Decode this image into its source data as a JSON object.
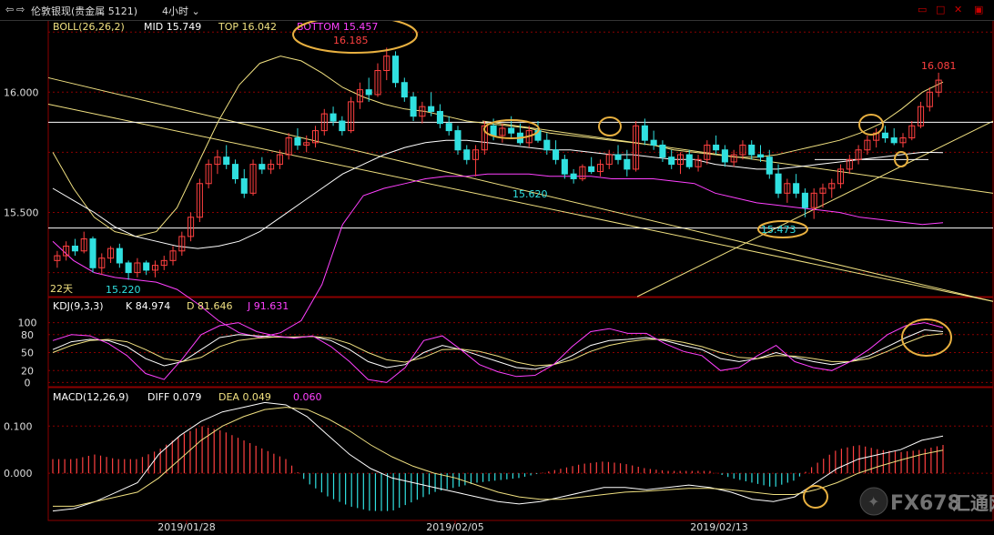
{
  "toolbar": {
    "instrument": "伦敦银现(贵金属 5121)",
    "period": "4小时"
  },
  "colors": {
    "up": "#ff4040",
    "down": "#30e0e0",
    "yellow": "#f0e080",
    "magenta": "#ff40ff",
    "white": "#ffffff",
    "orange": "#e8b040"
  },
  "boll": {
    "header": "BOLL(26,26,2)",
    "mid_label": "MID 15.749",
    "top_label": "TOP 16.042",
    "bottom_label": "BOTTOM 15.457"
  },
  "kdj": {
    "header": "KDJ(9,3,3)",
    "k_label": "K 84.974",
    "d_label": "D 81.646",
    "j_label": "J 91.631"
  },
  "macd": {
    "header": "MACD(12,26,9)",
    "diff_label": "DIFF 0.079",
    "dea_label": "DEA 0.049",
    "hist_label": "0.060"
  },
  "annotations": {
    "high": "16.185",
    "last_high": "16.081",
    "low1": "15.620",
    "low2": "15.473",
    "left_low": "15.220",
    "days": "22天"
  },
  "watermark": {
    "brand": "FX678",
    "cn": "汇通网"
  },
  "chart_data": [
    {
      "type": "candlestick",
      "title": "伦敦银现(贵金属 5121) 4小时",
      "yticks": [
        "16.000",
        "15.500"
      ],
      "ylim": [
        15.15,
        16.3
      ],
      "xticks": [
        "2019/01/28",
        "2019/02/05",
        "2019/02/13"
      ],
      "ohlc": [
        [
          15.3,
          15.34,
          15.27,
          15.32
        ],
        [
          15.32,
          15.38,
          15.3,
          15.36
        ],
        [
          15.36,
          15.39,
          15.32,
          15.34
        ],
        [
          15.34,
          15.42,
          15.33,
          15.39
        ],
        [
          15.39,
          15.4,
          15.25,
          15.27
        ],
        [
          15.27,
          15.33,
          15.24,
          15.31
        ],
        [
          15.31,
          15.36,
          15.29,
          15.35
        ],
        [
          15.35,
          15.37,
          15.27,
          15.29
        ],
        [
          15.29,
          15.3,
          15.22,
          15.25
        ],
        [
          15.25,
          15.31,
          15.23,
          15.29
        ],
        [
          15.29,
          15.3,
          15.24,
          15.26
        ],
        [
          15.26,
          15.3,
          15.23,
          15.28
        ],
        [
          15.28,
          15.32,
          15.26,
          15.3
        ],
        [
          15.3,
          15.36,
          15.28,
          15.34
        ],
        [
          15.34,
          15.42,
          15.32,
          15.4
        ],
        [
          15.4,
          15.5,
          15.38,
          15.48
        ],
        [
          15.48,
          15.64,
          15.46,
          15.62
        ],
        [
          15.62,
          15.72,
          15.6,
          15.7
        ],
        [
          15.7,
          15.76,
          15.66,
          15.73
        ],
        [
          15.73,
          15.78,
          15.68,
          15.7
        ],
        [
          15.7,
          15.72,
          15.62,
          15.64
        ],
        [
          15.64,
          15.68,
          15.56,
          15.58
        ],
        [
          15.58,
          15.72,
          15.57,
          15.7
        ],
        [
          15.7,
          15.73,
          15.66,
          15.68
        ],
        [
          15.68,
          15.72,
          15.66,
          15.7
        ],
        [
          15.7,
          15.76,
          15.68,
          15.74
        ],
        [
          15.74,
          15.83,
          15.72,
          15.81
        ],
        [
          15.81,
          15.85,
          15.76,
          15.78
        ],
        [
          15.78,
          15.82,
          15.75,
          15.79
        ],
        [
          15.79,
          15.86,
          15.77,
          15.84
        ],
        [
          15.84,
          15.93,
          15.82,
          15.91
        ],
        [
          15.91,
          15.94,
          15.86,
          15.88
        ],
        [
          15.88,
          15.9,
          15.82,
          15.84
        ],
        [
          15.84,
          15.98,
          15.83,
          15.96
        ],
        [
          15.96,
          16.04,
          15.93,
          16.01
        ],
        [
          16.01,
          16.06,
          15.96,
          15.99
        ],
        [
          15.99,
          16.12,
          15.98,
          16.09
        ],
        [
          16.09,
          16.185,
          16.05,
          16.15
        ],
        [
          16.15,
          16.17,
          16.02,
          16.04
        ],
        [
          16.04,
          16.06,
          15.96,
          15.98
        ],
        [
          15.98,
          16.0,
          15.88,
          15.9
        ],
        [
          15.9,
          15.96,
          15.87,
          15.94
        ],
        [
          15.94,
          16.0,
          15.9,
          15.92
        ],
        [
          15.92,
          15.95,
          15.85,
          15.87
        ],
        [
          15.87,
          15.9,
          15.82,
          15.84
        ],
        [
          15.84,
          15.86,
          15.74,
          15.76
        ],
        [
          15.76,
          15.78,
          15.7,
          15.72
        ],
        [
          15.72,
          15.78,
          15.65,
          15.76
        ],
        [
          15.76,
          15.88,
          15.74,
          15.86
        ],
        [
          15.86,
          15.89,
          15.8,
          15.82
        ],
        [
          15.82,
          15.87,
          15.79,
          15.85
        ],
        [
          15.85,
          15.9,
          15.81,
          15.83
        ],
        [
          15.83,
          15.87,
          15.78,
          15.79
        ],
        [
          15.79,
          15.86,
          15.77,
          15.84
        ],
        [
          15.84,
          15.88,
          15.79,
          15.8
        ],
        [
          15.8,
          15.83,
          15.74,
          15.76
        ],
        [
          15.76,
          15.8,
          15.7,
          15.72
        ],
        [
          15.72,
          15.74,
          15.64,
          15.66
        ],
        [
          15.66,
          15.68,
          15.62,
          15.64
        ],
        [
          15.64,
          15.7,
          15.63,
          15.69
        ],
        [
          15.69,
          15.73,
          15.66,
          15.67
        ],
        [
          15.67,
          15.72,
          15.65,
          15.7
        ],
        [
          15.7,
          15.76,
          15.68,
          15.74
        ],
        [
          15.74,
          15.78,
          15.7,
          15.72
        ],
        [
          15.72,
          15.76,
          15.65,
          15.68
        ],
        [
          15.68,
          15.88,
          15.67,
          15.86
        ],
        [
          15.86,
          15.89,
          15.78,
          15.8
        ],
        [
          15.8,
          15.84,
          15.76,
          15.78
        ],
        [
          15.78,
          15.8,
          15.71,
          15.73
        ],
        [
          15.73,
          15.76,
          15.68,
          15.7
        ],
        [
          15.7,
          15.75,
          15.66,
          15.74
        ],
        [
          15.74,
          15.76,
          15.68,
          15.69
        ],
        [
          15.69,
          15.74,
          15.67,
          15.72
        ],
        [
          15.72,
          15.8,
          15.7,
          15.78
        ],
        [
          15.78,
          15.82,
          15.74,
          15.76
        ],
        [
          15.76,
          15.78,
          15.69,
          15.71
        ],
        [
          15.71,
          15.76,
          15.69,
          15.74
        ],
        [
          15.74,
          15.8,
          15.72,
          15.78
        ],
        [
          15.78,
          15.8,
          15.72,
          15.74
        ],
        [
          15.74,
          15.78,
          15.71,
          15.73
        ],
        [
          15.73,
          15.76,
          15.64,
          15.66
        ],
        [
          15.66,
          15.7,
          15.56,
          15.58
        ],
        [
          15.58,
          15.64,
          15.54,
          15.62
        ],
        [
          15.62,
          15.66,
          15.56,
          15.58
        ],
        [
          15.58,
          15.6,
          15.48,
          15.52
        ],
        [
          15.52,
          15.6,
          15.473,
          15.58
        ],
        [
          15.58,
          15.62,
          15.52,
          15.6
        ],
        [
          15.6,
          15.64,
          15.56,
          15.62
        ],
        [
          15.62,
          15.7,
          15.6,
          15.68
        ],
        [
          15.68,
          15.74,
          15.66,
          15.72
        ],
        [
          15.72,
          15.78,
          15.7,
          15.76
        ],
        [
          15.76,
          15.82,
          15.74,
          15.8
        ],
        [
          15.8,
          15.85,
          15.77,
          15.83
        ],
        [
          15.83,
          15.86,
          15.79,
          15.81
        ],
        [
          15.81,
          15.85,
          15.78,
          15.79
        ],
        [
          15.79,
          15.83,
          15.77,
          15.81
        ],
        [
          15.81,
          15.88,
          15.8,
          15.86
        ],
        [
          15.86,
          15.96,
          15.85,
          15.94
        ],
        [
          15.94,
          16.02,
          15.92,
          16.0
        ],
        [
          16.0,
          16.081,
          15.98,
          16.05
        ]
      ],
      "boll_mid": [
        15.6,
        15.55,
        15.5,
        15.44,
        15.4,
        15.38,
        15.36,
        15.35,
        15.36,
        15.38,
        15.42,
        15.48,
        15.54,
        15.6,
        15.66,
        15.7,
        15.74,
        15.77,
        15.79,
        15.8,
        15.8,
        15.79,
        15.78,
        15.77,
        15.76,
        15.76,
        15.75,
        15.74,
        15.74,
        15.73,
        15.72,
        15.72,
        15.7,
        15.69,
        15.68,
        15.68,
        15.69,
        15.7,
        15.71,
        15.72,
        15.73,
        15.74,
        15.75,
        15.749
      ],
      "boll_top": [
        15.75,
        15.6,
        15.48,
        15.42,
        15.4,
        15.42,
        15.52,
        15.7,
        15.88,
        16.03,
        16.12,
        16.15,
        16.13,
        16.08,
        16.02,
        15.98,
        15.95,
        15.93,
        15.92,
        15.9,
        15.88,
        15.87,
        15.86,
        15.85,
        15.83,
        15.82,
        15.81,
        15.8,
        15.79,
        15.78,
        15.76,
        15.75,
        15.74,
        15.73,
        15.73,
        15.74,
        15.76,
        15.78,
        15.8,
        15.83,
        15.87,
        15.93,
        16.0,
        16.042
      ],
      "boll_bottom": [
        15.38,
        15.3,
        15.25,
        15.23,
        15.22,
        15.21,
        15.18,
        15.12,
        15.05,
        15.0,
        14.98,
        15.0,
        15.05,
        15.2,
        15.45,
        15.57,
        15.6,
        15.62,
        15.64,
        15.65,
        15.65,
        15.66,
        15.66,
        15.66,
        15.65,
        15.65,
        15.65,
        15.64,
        15.64,
        15.64,
        15.63,
        15.62,
        15.58,
        15.56,
        15.54,
        15.53,
        15.52,
        15.51,
        15.5,
        15.48,
        15.47,
        15.46,
        15.45,
        15.457
      ]
    },
    {
      "type": "line",
      "title": "KDJ(9,3,3)",
      "yticks": [
        0,
        20,
        50,
        80,
        100
      ],
      "ylim": [
        -10,
        110
      ],
      "series": [
        {
          "name": "K",
          "values": [
            55,
            68,
            72,
            70,
            60,
            40,
            28,
            35,
            55,
            75,
            80,
            78,
            76,
            75,
            77,
            70,
            55,
            35,
            25,
            30,
            50,
            62,
            55,
            45,
            35,
            25,
            22,
            30,
            45,
            62,
            70,
            72,
            75,
            70,
            62,
            55,
            40,
            35,
            40,
            50,
            42,
            35,
            30,
            35,
            45,
            60,
            75,
            88,
            84.974
          ]
        },
        {
          "name": "D",
          "values": [
            50,
            62,
            70,
            72,
            68,
            55,
            40,
            35,
            42,
            60,
            70,
            74,
            76,
            76,
            77,
            74,
            65,
            50,
            38,
            34,
            42,
            55,
            56,
            52,
            44,
            34,
            28,
            30,
            38,
            52,
            62,
            68,
            72,
            72,
            67,
            60,
            50,
            42,
            40,
            45,
            44,
            40,
            35,
            35,
            40,
            52,
            66,
            78,
            81.646
          ]
        },
        {
          "name": "J",
          "values": [
            70,
            80,
            78,
            65,
            45,
            15,
            5,
            40,
            80,
            95,
            100,
            85,
            78,
            74,
            78,
            60,
            35,
            5,
            0,
            25,
            70,
            78,
            55,
            30,
            18,
            10,
            12,
            30,
            60,
            85,
            90,
            82,
            82,
            65,
            52,
            45,
            20,
            25,
            45,
            62,
            35,
            25,
            20,
            35,
            55,
            80,
            95,
            100,
            91.631
          ]
        }
      ]
    },
    {
      "type": "bar",
      "title": "MACD(12,26,9)",
      "yticks": [
        "0.100",
        "0.000"
      ],
      "ylim": [
        -0.1,
        0.17
      ],
      "series": [
        {
          "name": "DIFF",
          "values": [
            -0.08,
            -0.075,
            -0.06,
            -0.04,
            -0.02,
            0.04,
            0.08,
            0.11,
            0.13,
            0.14,
            0.15,
            0.145,
            0.12,
            0.08,
            0.04,
            0.01,
            -0.01,
            -0.02,
            -0.03,
            -0.04,
            -0.05,
            -0.06,
            -0.065,
            -0.06,
            -0.05,
            -0.04,
            -0.03,
            -0.03,
            -0.035,
            -0.03,
            -0.025,
            -0.03,
            -0.04,
            -0.055,
            -0.06,
            -0.05,
            -0.02,
            0.01,
            0.03,
            0.04,
            0.05,
            0.07,
            0.079
          ]
        },
        {
          "name": "DEA",
          "values": [
            -0.07,
            -0.07,
            -0.06,
            -0.05,
            -0.04,
            -0.01,
            0.03,
            0.07,
            0.1,
            0.12,
            0.135,
            0.14,
            0.135,
            0.115,
            0.09,
            0.06,
            0.035,
            0.015,
            0.0,
            -0.01,
            -0.025,
            -0.04,
            -0.05,
            -0.055,
            -0.055,
            -0.05,
            -0.045,
            -0.04,
            -0.038,
            -0.035,
            -0.032,
            -0.032,
            -0.035,
            -0.04,
            -0.045,
            -0.045,
            -0.035,
            -0.02,
            0.0,
            0.015,
            0.028,
            0.04,
            0.049
          ]
        },
        {
          "name": "MACD",
          "values": [
            0.03,
            0.03,
            0.04,
            0.03,
            0.03,
            0.05,
            0.08,
            0.1,
            0.09,
            0.07,
            0.05,
            0.03,
            -0.02,
            -0.05,
            -0.07,
            -0.08,
            -0.08,
            -0.06,
            -0.04,
            -0.03,
            -0.02,
            -0.015,
            -0.01,
            0.0,
            0.01,
            0.02,
            0.025,
            0.02,
            0.01,
            0.005,
            0.005,
            0.005,
            -0.01,
            -0.02,
            -0.03,
            -0.015,
            0.02,
            0.05,
            0.06,
            0.05,
            0.045,
            0.05,
            0.06
          ]
        }
      ]
    }
  ]
}
